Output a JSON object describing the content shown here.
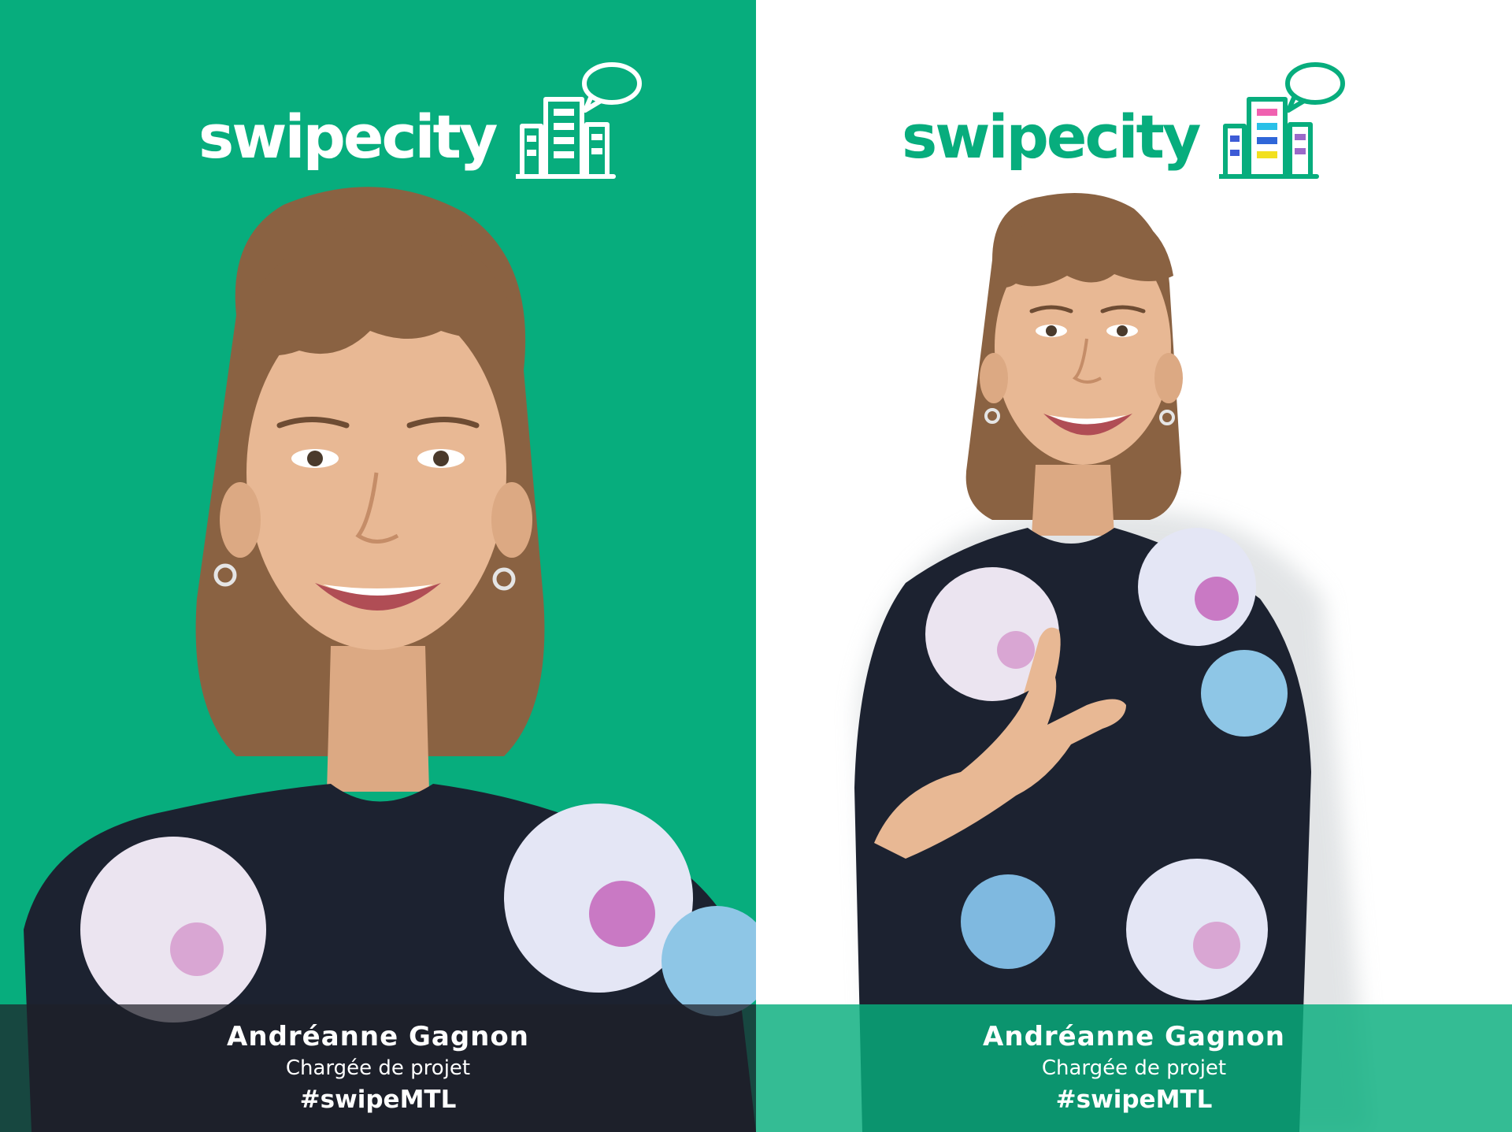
{
  "left_card": {
    "logo_text": "swipecity",
    "logo_icon": "city-buildings-speech-bubble-icon",
    "person_name": "Andréanne Gagnon",
    "person_role": "Chargée de projet",
    "hashtag": "#swipeMTL"
  },
  "right_card": {
    "logo_text": "swipecity",
    "logo_icon": "city-buildings-speech-bubble-icon",
    "person_name": "Andréanne Gagnon",
    "person_role": "Chargée de projet",
    "hashtag": "#swipeMTL"
  },
  "colors": {
    "brand_green": "#07ad7d",
    "dark_overlay": "#1e2028",
    "white": "#ffffff",
    "shirt": "#1c2230",
    "hair": "#8a6242",
    "skin": "#e8b894"
  }
}
